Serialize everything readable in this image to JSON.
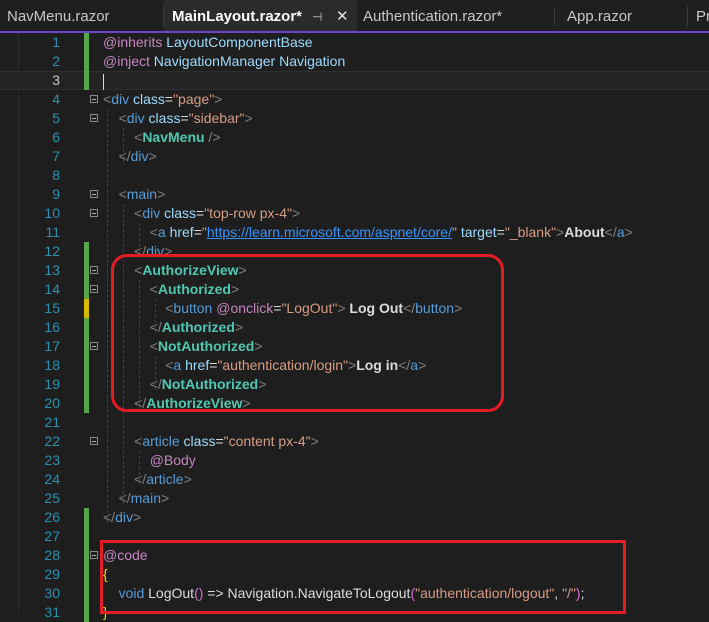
{
  "tabs": [
    {
      "label": "NavMenu.razor",
      "active": false
    },
    {
      "label": "MainLayout.razor*",
      "active": true,
      "pin_icon": "pin-icon",
      "close_icon": "close-icon"
    },
    {
      "label": "Authentication.razor*",
      "active": false
    },
    {
      "label": "App.razor",
      "active": false
    },
    {
      "label": "Pr",
      "active": false
    }
  ],
  "icons": {
    "pin": "⊣",
    "close": "✕"
  },
  "colors": {
    "accent": "#6e44c7",
    "annotation": "#e41c23",
    "change_bar": "#57a64a",
    "line_number": "#2b91af"
  },
  "editor": {
    "current_line": 3,
    "lines": [
      {
        "n": 1,
        "tokens": [
          [
            "dv",
            "@inherits "
          ],
          [
            "at",
            "LayoutComponentBase"
          ]
        ]
      },
      {
        "n": 2,
        "tokens": [
          [
            "dv",
            "@inject "
          ],
          [
            "at",
            "NavigationManager Navigation"
          ]
        ]
      },
      {
        "n": 3,
        "tokens": []
      },
      {
        "n": 4,
        "tokens": [
          [
            "g",
            "<"
          ],
          [
            "tg",
            "div "
          ],
          [
            "at",
            "class"
          ],
          [
            "pl",
            "="
          ],
          [
            "st",
            "\"page\""
          ],
          [
            "g",
            ">"
          ]
        ]
      },
      {
        "n": 5,
        "tokens": [
          [
            "pl",
            "    "
          ],
          [
            "g",
            "<"
          ],
          [
            "tg",
            "div "
          ],
          [
            "at",
            "class"
          ],
          [
            "pl",
            "="
          ],
          [
            "st",
            "\"sidebar\""
          ],
          [
            "g",
            ">"
          ]
        ]
      },
      {
        "n": 6,
        "tokens": [
          [
            "pl",
            "        "
          ],
          [
            "g",
            "<"
          ],
          [
            "cp",
            "NavMenu"
          ],
          [
            "g",
            " />"
          ]
        ]
      },
      {
        "n": 7,
        "tokens": [
          [
            "pl",
            "    "
          ],
          [
            "g",
            "</"
          ],
          [
            "tg",
            "div"
          ],
          [
            "g",
            ">"
          ]
        ]
      },
      {
        "n": 8,
        "tokens": []
      },
      {
        "n": 9,
        "tokens": [
          [
            "pl",
            "    "
          ],
          [
            "g",
            "<"
          ],
          [
            "tg",
            "main"
          ],
          [
            "g",
            ">"
          ]
        ]
      },
      {
        "n": 10,
        "tokens": [
          [
            "pl",
            "        "
          ],
          [
            "g",
            "<"
          ],
          [
            "tg",
            "div "
          ],
          [
            "at",
            "class"
          ],
          [
            "pl",
            "="
          ],
          [
            "st",
            "\"top-row px-4\""
          ],
          [
            "g",
            ">"
          ]
        ]
      },
      {
        "n": 11,
        "tokens": [
          [
            "pl",
            "            "
          ],
          [
            "g",
            "<"
          ],
          [
            "tg",
            "a "
          ],
          [
            "at",
            "href"
          ],
          [
            "pl",
            "="
          ],
          [
            "st",
            "\""
          ],
          [
            "lk",
            "https://learn.microsoft.com/aspnet/core/"
          ],
          [
            "st",
            "\""
          ],
          [
            "pl",
            " "
          ],
          [
            "at",
            "target"
          ],
          [
            "pl",
            "="
          ],
          [
            "st",
            "\"_blank\""
          ],
          [
            "g",
            ">"
          ],
          [
            "tx",
            "About"
          ],
          [
            "g",
            "</"
          ],
          [
            "tg",
            "a"
          ],
          [
            "g",
            ">"
          ]
        ]
      },
      {
        "n": 12,
        "tokens": [
          [
            "pl",
            "        "
          ],
          [
            "g",
            "</"
          ],
          [
            "tg",
            "div"
          ],
          [
            "g",
            ">"
          ]
        ]
      },
      {
        "n": 13,
        "tokens": [
          [
            "pl",
            "        "
          ],
          [
            "g",
            "<"
          ],
          [
            "cp",
            "AuthorizeView"
          ],
          [
            "g",
            ">"
          ]
        ]
      },
      {
        "n": 14,
        "tokens": [
          [
            "pl",
            "            "
          ],
          [
            "g",
            "<"
          ],
          [
            "cp",
            "Authorized"
          ],
          [
            "g",
            ">"
          ]
        ]
      },
      {
        "n": 15,
        "tokens": [
          [
            "pl",
            "                "
          ],
          [
            "g",
            "<"
          ],
          [
            "tg",
            "button "
          ],
          [
            "dv",
            "@onclick"
          ],
          [
            "pl",
            "="
          ],
          [
            "st",
            "\"LogOut\""
          ],
          [
            "g",
            ">"
          ],
          [
            "tx",
            " Log Out"
          ],
          [
            "g",
            "</"
          ],
          [
            "tg",
            "button"
          ],
          [
            "g",
            ">"
          ]
        ]
      },
      {
        "n": 16,
        "tokens": [
          [
            "pl",
            "            "
          ],
          [
            "g",
            "</"
          ],
          [
            "cp",
            "Authorized"
          ],
          [
            "g",
            ">"
          ]
        ]
      },
      {
        "n": 17,
        "tokens": [
          [
            "pl",
            "            "
          ],
          [
            "g",
            "<"
          ],
          [
            "cp",
            "NotAuthorized"
          ],
          [
            "g",
            ">"
          ]
        ]
      },
      {
        "n": 18,
        "tokens": [
          [
            "pl",
            "                "
          ],
          [
            "g",
            "<"
          ],
          [
            "tg",
            "a "
          ],
          [
            "at",
            "href"
          ],
          [
            "pl",
            "="
          ],
          [
            "st",
            "\"authentication/login\""
          ],
          [
            "g",
            ">"
          ],
          [
            "tx",
            "Log in"
          ],
          [
            "g",
            "</"
          ],
          [
            "tg",
            "a"
          ],
          [
            "g",
            ">"
          ]
        ]
      },
      {
        "n": 19,
        "tokens": [
          [
            "pl",
            "            "
          ],
          [
            "g",
            "</"
          ],
          [
            "cp",
            "NotAuthorized"
          ],
          [
            "g",
            ">"
          ]
        ]
      },
      {
        "n": 20,
        "tokens": [
          [
            "pl",
            "        "
          ],
          [
            "g",
            "</"
          ],
          [
            "cp",
            "AuthorizeView"
          ],
          [
            "g",
            ">"
          ]
        ]
      },
      {
        "n": 21,
        "tokens": []
      },
      {
        "n": 22,
        "tokens": [
          [
            "pl",
            "        "
          ],
          [
            "g",
            "<"
          ],
          [
            "tg",
            "article "
          ],
          [
            "at",
            "class"
          ],
          [
            "pl",
            "="
          ],
          [
            "st",
            "\"content px-4\""
          ],
          [
            "g",
            ">"
          ]
        ]
      },
      {
        "n": 23,
        "tokens": [
          [
            "pl",
            "            "
          ],
          [
            "dv",
            "@Body"
          ]
        ]
      },
      {
        "n": 24,
        "tokens": [
          [
            "pl",
            "        "
          ],
          [
            "g",
            "</"
          ],
          [
            "tg",
            "article"
          ],
          [
            "g",
            ">"
          ]
        ]
      },
      {
        "n": 25,
        "tokens": [
          [
            "pl",
            "    "
          ],
          [
            "g",
            "</"
          ],
          [
            "tg",
            "main"
          ],
          [
            "g",
            ">"
          ]
        ]
      },
      {
        "n": 26,
        "tokens": [
          [
            "g",
            "</"
          ],
          [
            "tg",
            "div"
          ],
          [
            "g",
            ">"
          ]
        ]
      },
      {
        "n": 27,
        "tokens": []
      },
      {
        "n": 28,
        "tokens": [
          [
            "dv",
            "@code"
          ]
        ]
      },
      {
        "n": 29,
        "tokens": [
          [
            "yb",
            "{"
          ]
        ]
      },
      {
        "n": 30,
        "tokens": [
          [
            "pl",
            "    "
          ],
          [
            "tg",
            "void "
          ],
          [
            "pl",
            "LogOut"
          ],
          [
            "pb",
            "()"
          ],
          [
            "pl",
            " => Navigation.NavigateToLogout"
          ],
          [
            "pb",
            "("
          ],
          [
            "st",
            "\"authentication/logout\""
          ],
          [
            "pl",
            ", "
          ],
          [
            "st",
            "\"/\""
          ],
          [
            "pb",
            ")"
          ],
          [
            "pl",
            ";"
          ]
        ]
      },
      {
        "n": 31,
        "tokens": [
          [
            "yb",
            "}"
          ]
        ]
      }
    ]
  }
}
